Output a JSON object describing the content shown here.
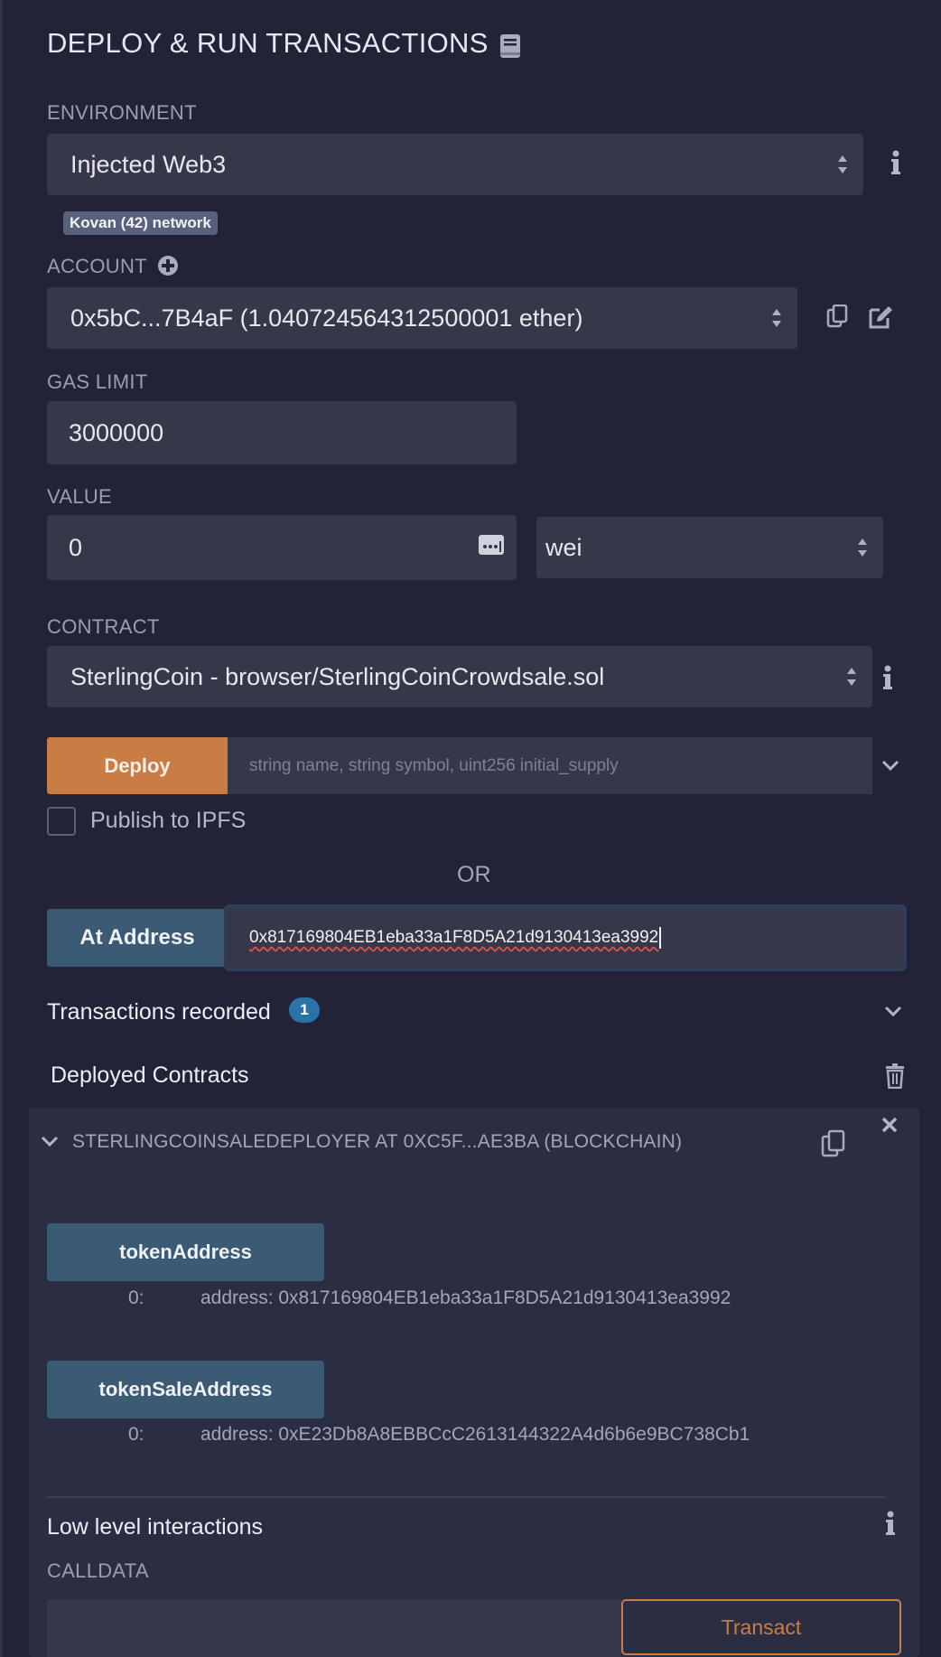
{
  "panel": {
    "title": "DEPLOY & RUN TRANSACTIONS"
  },
  "environment": {
    "label": "ENVIRONMENT",
    "value": "Injected Web3",
    "network_badge": "Kovan (42) network"
  },
  "account": {
    "label": "ACCOUNT",
    "value": "0x5bC...7B4aF (1.040724564312500001 ether)"
  },
  "gas_limit": {
    "label": "GAS LIMIT",
    "value": "3000000"
  },
  "value": {
    "label": "VALUE",
    "amount": "0",
    "unit": "wei"
  },
  "contract": {
    "label": "CONTRACT",
    "value": "SterlingCoin - browser/SterlingCoinCrowdsale.sol"
  },
  "deploy": {
    "button": "Deploy",
    "params_placeholder": "string name, string symbol, uint256 initial_supply",
    "publish_label": "Publish to IPFS"
  },
  "or_label": "OR",
  "at_address": {
    "button": "At Address",
    "value": "0x817169804EB1eba33a1F8D5A21d9130413ea3992"
  },
  "transactions": {
    "label": "Transactions recorded",
    "count": "1"
  },
  "deployed": {
    "label": "Deployed Contracts",
    "instance_title": "STERLINGCOINSALEDEPLOYER AT 0XC5F...AE3BA (BLOCKCHAIN)",
    "functions": [
      {
        "name": "tokenAddress",
        "index": "0:",
        "result": "address: 0x817169804EB1eba33a1F8D5A21d9130413ea3992"
      },
      {
        "name": "tokenSaleAddress",
        "index": "0:",
        "result": "address: 0xE23Db8A8EBBCcC2613144322A4d6b6e9BC738Cb1"
      }
    ],
    "low_level_label": "Low level interactions",
    "calldata_label": "CALLDATA",
    "transact_button": "Transact"
  },
  "colors": {
    "background": "#222336",
    "field": "#363849",
    "deploy_orange": "#c97d45",
    "function_blue": "#3b5b75",
    "badge_blue": "#2a73a8"
  }
}
